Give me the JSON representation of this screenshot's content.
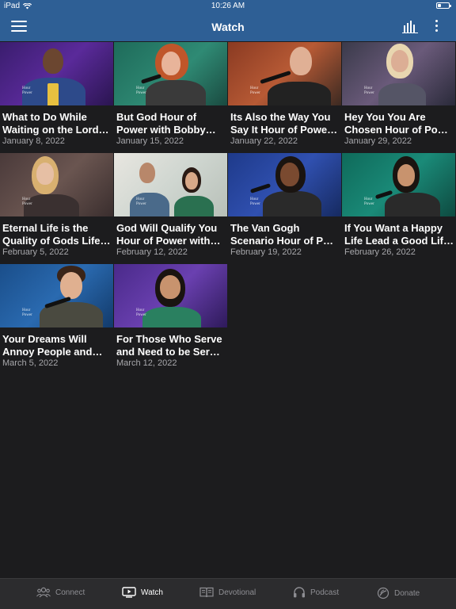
{
  "status": {
    "device": "iPad",
    "time": "10:26 AM"
  },
  "header": {
    "title": "Watch"
  },
  "videos": [
    {
      "title_line1": "What to Do While",
      "title_line2": "Waiting on the Lord…",
      "date": "January 8, 2022"
    },
    {
      "title_line1": "But God Hour of",
      "title_line2": "Power with Bobby…",
      "date": "January 15, 2022"
    },
    {
      "title_line1": "Its Also the Way You",
      "title_line2": "Say It Hour of Powe…",
      "date": "January 22, 2022"
    },
    {
      "title_line1": "Hey You You Are",
      "title_line2": "Chosen Hour of Po…",
      "date": "January 29, 2022"
    },
    {
      "title_line1": "Eternal Life is the",
      "title_line2": "Quality of Gods Life…",
      "date": "February 5, 2022"
    },
    {
      "title_line1": "God Will Qualify You",
      "title_line2": "Hour of Power with…",
      "date": "February 12, 2022"
    },
    {
      "title_line1": "The Van Gogh",
      "title_line2": "Scenario Hour of P…",
      "date": "February 19, 2022"
    },
    {
      "title_line1": "If You Want a Happy",
      "title_line2": "Life Lead a Good Lif…",
      "date": "February 26, 2022"
    },
    {
      "title_line1": "Your Dreams Will",
      "title_line2": "Annoy People and…",
      "date": "March 5, 2022"
    },
    {
      "title_line1": "For Those Who Serve",
      "title_line2": "and Need to be Ser…",
      "date": "March 12, 2022"
    }
  ],
  "thumb_watermark": {
    "line1": "Hour",
    "line2": "of",
    "line3": "Power"
  },
  "tabs": {
    "connect": "Connect",
    "watch": "Watch",
    "devotional": "Devotional",
    "podcast": "Podcast",
    "donate": "Donate"
  },
  "colors": {
    "header": "#2e5f95",
    "background": "#1c1c1e",
    "tabbar": "#2c2c2e",
    "inactive": "#8e8e93"
  }
}
